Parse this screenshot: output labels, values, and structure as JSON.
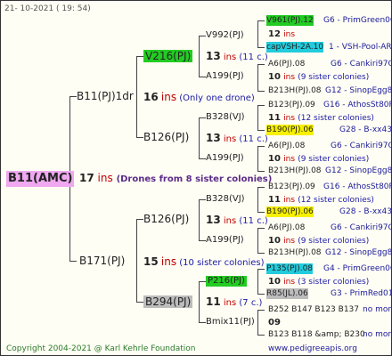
{
  "header": {
    "date": "21- 10-2021 ( 19: 54)"
  },
  "footer": {
    "copyright": "Copyright 2004-2021 @ Karl Kehrle Foundation",
    "url": "www.pedigreeapis.org"
  },
  "root": {
    "label": "B11(AMC)",
    "ins_num": "17",
    "ins": "ins",
    "note": "(Drones from 8 sister colonies)"
  },
  "gen1": [
    {
      "label": "B11(PJ)1dr",
      "ins_num": "16",
      "ins": "ins",
      "note": "(Only one drone)"
    },
    {
      "label": "B171(PJ)",
      "ins_num": "15",
      "ins": "ins",
      "note": "(10 sister colonies)"
    }
  ],
  "gen2": [
    {
      "label": "V216(PJ)",
      "ins_num": "13",
      "ins": "ins",
      "note": "(11 c.)"
    },
    {
      "label": "B126(PJ)",
      "ins_num": "13",
      "ins": "ins",
      "note": "(11 c.)"
    },
    {
      "label": "B126(PJ)",
      "ins_num": "13",
      "ins": "ins",
      "note": "(11 c.)"
    },
    {
      "label": "B294(PJ)",
      "ins_num": "11",
      "ins": "ins",
      "note": "(7 c.)"
    }
  ],
  "gen3": [
    {
      "label": "V992(PJ)"
    },
    {
      "label": "A199(PJ)"
    },
    {
      "label": "B328(VJ)"
    },
    {
      "label": "A199(PJ)"
    },
    {
      "label": "B328(VJ)"
    },
    {
      "label": "A199(PJ)"
    },
    {
      "label": "P216(PJ)"
    },
    {
      "label": "Bmix11(PJ)"
    }
  ],
  "gen4": [
    {
      "label": "V961(PJ).12",
      "tag": "G6 - PrimGreen00"
    },
    {
      "ins_num": "12",
      "ins": "ins"
    },
    {
      "label": "capVSH-2A.10",
      "tag": "1 - VSH-Pool-AR"
    },
    {
      "label": "A6(PJ).08",
      "tag": "G6 - Cankiri97Q"
    },
    {
      "ins_num": "10",
      "ins": "ins",
      "note": "(9 sister colonies)"
    },
    {
      "label": "B213H(PJ).08",
      "tag": "G12 - SinopEgg86R"
    },
    {
      "label": "B123(PJ).09",
      "tag": "G16 - AthosSt80R"
    },
    {
      "ins_num": "11",
      "ins": "ins",
      "note": "(12 sister colonies)"
    },
    {
      "label": "B190(PJ).06",
      "tag": "G28 - B-xx43"
    },
    {
      "label": "A6(PJ).08",
      "tag": "G6 - Cankiri97Q"
    },
    {
      "ins_num": "10",
      "ins": "ins",
      "note": "(9 sister colonies)"
    },
    {
      "label": "B213H(PJ).08",
      "tag": "G12 - SinopEgg86R"
    },
    {
      "label": "B123(PJ).09",
      "tag": "G16 - AthosSt80R"
    },
    {
      "ins_num": "11",
      "ins": "ins",
      "note": "(12 sister colonies)"
    },
    {
      "label": "B190(PJ).06",
      "tag": "G28 - B-xx43"
    },
    {
      "label": "A6(PJ).08",
      "tag": "G6 - Cankiri97Q"
    },
    {
      "ins_num": "10",
      "ins": "ins",
      "note": "(9 sister colonies)"
    },
    {
      "label": "B213H(PJ).08",
      "tag": "G12 - SinopEgg86R"
    },
    {
      "label": "P135(PJ).08",
      "tag": "G4 - PrimGreen00"
    },
    {
      "ins_num": "10",
      "ins": "ins",
      "note": "(3 sister colonies)"
    },
    {
      "label": "R85(JL).06",
      "tag": "G3 - PrimRed01"
    },
    {
      "label": "B252 B147 B123 B137",
      "tag": "no more"
    },
    {
      "ins_num": "09"
    },
    {
      "label": "B123 B118 &amp; B230",
      "tag": "no more"
    }
  ]
}
